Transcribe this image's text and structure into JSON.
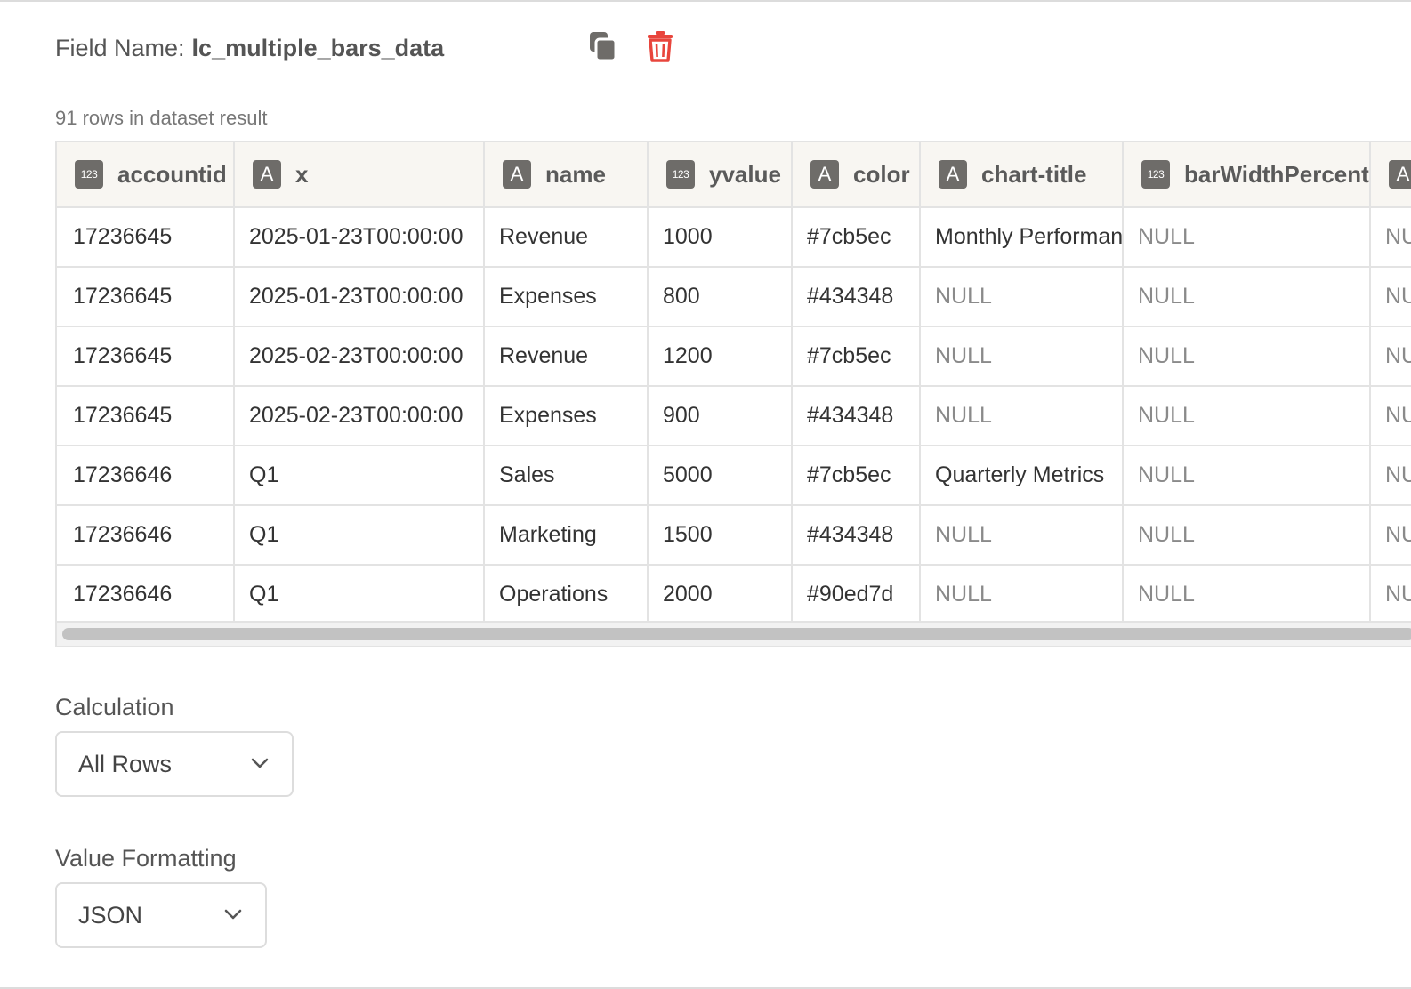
{
  "field": {
    "label": "Field Name:",
    "value": "lc_multiple_bars_data"
  },
  "icons": {
    "copy": "copy-icon",
    "delete": "trash-icon"
  },
  "colors": {
    "delete": "#e8453c",
    "badge": "#6e6c69",
    "header_bg": "#f8f6f2"
  },
  "dataset": {
    "rows_label": "91 rows in dataset result",
    "columns": [
      {
        "label": "accountid",
        "type": "123"
      },
      {
        "label": "x",
        "type": "A"
      },
      {
        "label": "name",
        "type": "A"
      },
      {
        "label": "yvalue",
        "type": "123"
      },
      {
        "label": "color",
        "type": "A"
      },
      {
        "label": "chart-title",
        "type": "A"
      },
      {
        "label": "barWidthPercent",
        "type": "123"
      },
      {
        "label": "",
        "type": "A"
      }
    ],
    "rows": [
      [
        "17236645",
        "2025-01-23T00:00:00",
        "Revenue",
        "1000",
        "#7cb5ec",
        "Monthly Performance",
        "NULL",
        "NULL"
      ],
      [
        "17236645",
        "2025-01-23T00:00:00",
        "Expenses",
        "800",
        "#434348",
        "NULL",
        "NULL",
        "NULL"
      ],
      [
        "17236645",
        "2025-02-23T00:00:00",
        "Revenue",
        "1200",
        "#7cb5ec",
        "NULL",
        "NULL",
        "NULL"
      ],
      [
        "17236645",
        "2025-02-23T00:00:00",
        "Expenses",
        "900",
        "#434348",
        "NULL",
        "NULL",
        "NULL"
      ],
      [
        "17236646",
        "Q1",
        "Sales",
        "5000",
        "#7cb5ec",
        "Quarterly Metrics",
        "NULL",
        "NULL"
      ],
      [
        "17236646",
        "Q1",
        "Marketing",
        "1500",
        "#434348",
        "NULL",
        "NULL",
        "NULL"
      ],
      [
        "17236646",
        "Q1",
        "Operations",
        "2000",
        "#90ed7d",
        "NULL",
        "NULL",
        "NULL"
      ]
    ]
  },
  "calculation": {
    "label": "Calculation",
    "selected": "All Rows"
  },
  "formatting": {
    "label": "Value Formatting",
    "selected": "JSON"
  }
}
